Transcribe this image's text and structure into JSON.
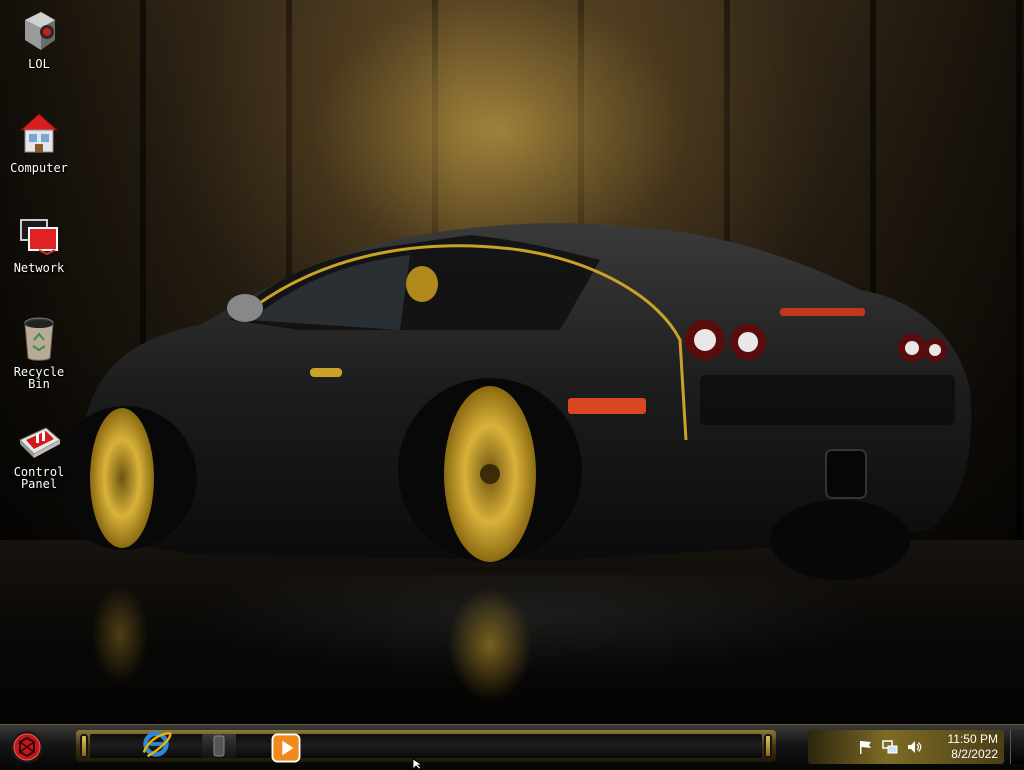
{
  "desktop": {
    "icons": [
      {
        "label": "LOL",
        "icon": "lol-app-icon"
      },
      {
        "label": "Computer",
        "icon": "computer-house-icon"
      },
      {
        "label": "Network",
        "icon": "network-icon"
      },
      {
        "label": "Recycle\nBin",
        "icon": "recycle-bin-icon"
      },
      {
        "label": "Control\nPanel",
        "icon": "control-panel-icon"
      }
    ]
  },
  "taskbar": {
    "start_icon": "start-orb-icon",
    "pinned": [
      {
        "name": "Internet Explorer",
        "icon": "internet-explorer-icon"
      },
      {
        "name": "Media",
        "icon": "media-icon"
      },
      {
        "name": "Media Player",
        "icon": "media-player-icon"
      }
    ],
    "tray": {
      "icons": [
        "action-center-flag-icon",
        "network-tray-icon",
        "volume-icon"
      ],
      "time": "11:50 PM",
      "date": "8/2/2022"
    }
  },
  "colors": {
    "accent_gold": "#c9a227",
    "taskbar_dark": "#151515"
  }
}
